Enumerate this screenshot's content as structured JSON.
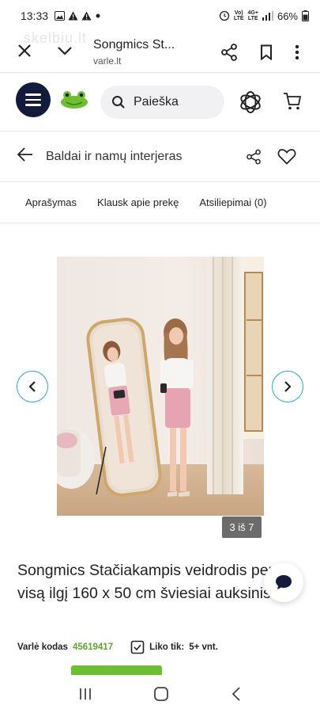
{
  "status_bar": {
    "time": "13:33",
    "network_labels": [
      "Vo)",
      "LTE",
      "4G+",
      "LTE"
    ],
    "battery": "66%"
  },
  "browser_tab": {
    "watermark": "skelbiu.lt",
    "title": "Songmics St...",
    "url": "varle.lt"
  },
  "site_header": {
    "search_label": "Paieška"
  },
  "category_bar": {
    "title": "Baldai ir namų interjeras"
  },
  "product_tabs": [
    "Aprašymas",
    "Klausk apie prekę",
    "Atsiliepimai (0)"
  ],
  "gallery": {
    "counter": "3 iš 7"
  },
  "product": {
    "title": "Songmics Stačiakampis veidrodis per visą ilgį 160 x 50 cm šviesiai auksinis",
    "code_label": "Varlė kodas",
    "code_value": "45619417",
    "stock_label": "Liko tik:",
    "stock_value": "5+ vnt."
  },
  "colors": {
    "brand_dark": "#121b3b",
    "accent_teal": "#2aa7c9",
    "brand_green": "#5aa625"
  }
}
